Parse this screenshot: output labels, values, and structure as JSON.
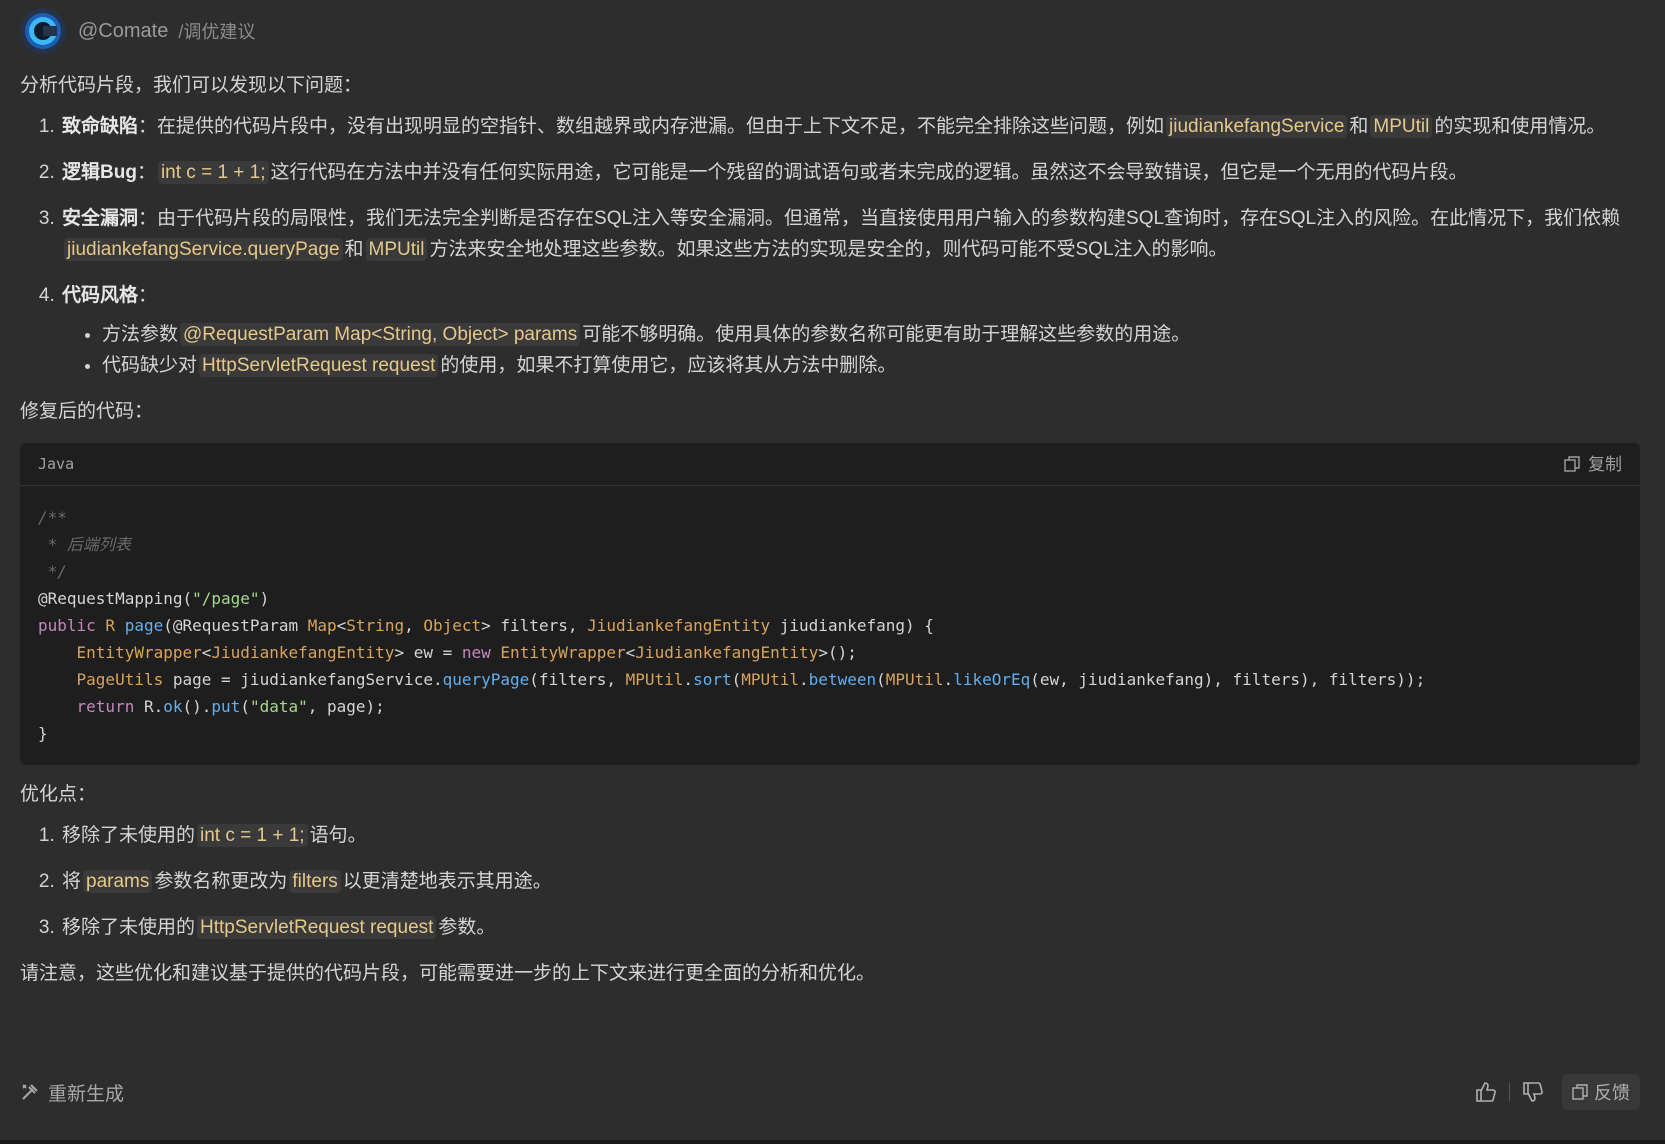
{
  "header": {
    "name": "@Comate",
    "command": "/调优建议"
  },
  "intro": "分析代码片段，我们可以发现以下问题：",
  "issues": {
    "i1": {
      "title": "致命缺陷",
      "colon": "：",
      "t1": "在提供的代码片段中，没有出现明显的空指针、数组越界或内存泄漏。但由于上下文不足，不能完全排除这些问题，例如",
      "c1": "jiudiankefangService",
      "t2": "和",
      "c2": "MPUtil",
      "t3": "的实现和使用情况。"
    },
    "i2": {
      "title": "逻辑Bug",
      "colon": "：",
      "c1": "int c = 1 + 1;",
      "t1": "这行代码在方法中并没有任何实际用途，它可能是一个残留的调试语句或者未完成的逻辑。虽然这不会导致错误，但它是一个无用的代码片段。"
    },
    "i3": {
      "title": "安全漏洞",
      "colon": "：",
      "t1": "由于代码片段的局限性，我们无法完全判断是否存在SQL注入等安全漏洞。但通常，当直接使用用户输入的参数构建SQL查询时，存在SQL注入的风险。在此情况下，我们依赖",
      "c1": "jiudiankefangService.queryPage",
      "t2": "和",
      "c2": "MPUtil",
      "t3": "方法来安全地处理这些参数。如果这些方法的实现是安全的，则代码可能不受SQL注入的影响。"
    },
    "i4": {
      "title": "代码风格",
      "colon": "：",
      "b1": {
        "t1": "方法参数",
        "c1": "@RequestParam Map<String, Object> params",
        "t2": "可能不够明确。使用具体的参数名称可能更有助于理解这些参数的用途。"
      },
      "b2": {
        "t1": "代码缺少对",
        "c1": "HttpServletRequest request",
        "t2": "的使用，如果不打算使用它，应该将其从方法中删除。"
      }
    }
  },
  "fixed_label": "修复后的代码：",
  "codeblock": {
    "language": "Java",
    "copy_label": "复制",
    "lines": {
      "l1": "/**",
      "l2": " * 后端列表",
      "l3": " */",
      "l4a": "@RequestMapping(",
      "l4b": "\"/page\"",
      "l4c": ")",
      "l5a": "public",
      "l5b": " R ",
      "l5c": "page",
      "l5d": "(@RequestParam ",
      "l5e": "Map",
      "l5f": "<",
      "l5g": "String",
      "l5h": ", ",
      "l5i": "Object",
      "l5j": "> filters, ",
      "l5k": "JiudiankefangEntity",
      "l5l": " jiudiankefang) {",
      "l6a": "    ",
      "l6b": "EntityWrapper",
      "l6c": "<",
      "l6d": "JiudiankefangEntity",
      "l6e": "> ew = ",
      "l6f": "new",
      "l6g": " ",
      "l6h": "EntityWrapper",
      "l6i": "<",
      "l6j": "JiudiankefangEntity",
      "l6k": ">();",
      "l7a": "    ",
      "l7b": "PageUtils",
      "l7c": " page = jiudiankefangService.",
      "l7d": "queryPage",
      "l7e": "(filters, ",
      "l7f": "MPUtil",
      "l7g": ".",
      "l7h": "sort",
      "l7i": "(",
      "l7j": "MPUtil",
      "l7k": ".",
      "l7l": "between",
      "l7m": "(",
      "l7n": "MPUtil",
      "l7o": ".",
      "l7p": "likeOrEq",
      "l7q": "(ew, jiudiankefang), filters), filters));",
      "l8a": "    ",
      "l8b": "return",
      "l8c": " R.",
      "l8d": "ok",
      "l8e": "().",
      "l8f": "put",
      "l8g": "(",
      "l8h": "\"data\"",
      "l8i": ", page);",
      "l9": "}"
    }
  },
  "opt_label": "优化点：",
  "opts": {
    "o1": {
      "t1": "移除了未使用的",
      "c1": "int c = 1 + 1;",
      "t2": "语句。"
    },
    "o2": {
      "t1": "将",
      "c1": "params",
      "t2": "参数名称更改为",
      "c2": "filters",
      "t3": "以更清楚地表示其用途。"
    },
    "o3": {
      "t1": "移除了未使用的",
      "c1": "HttpServletRequest request",
      "t2": "参数。"
    }
  },
  "note": "请注意，这些优化和建议基于提供的代码片段，可能需要进一步的上下文来进行更全面的分析和优化。",
  "footer": {
    "regenerate": "重新生成",
    "feedback": "反馈"
  },
  "icons": {
    "avatar": "comate-logo",
    "copy": "copy-icon",
    "regen": "regenerate-icon",
    "like": "thumbs-up-icon",
    "dislike": "thumbs-down-icon",
    "feedback": "feedback-icon"
  }
}
